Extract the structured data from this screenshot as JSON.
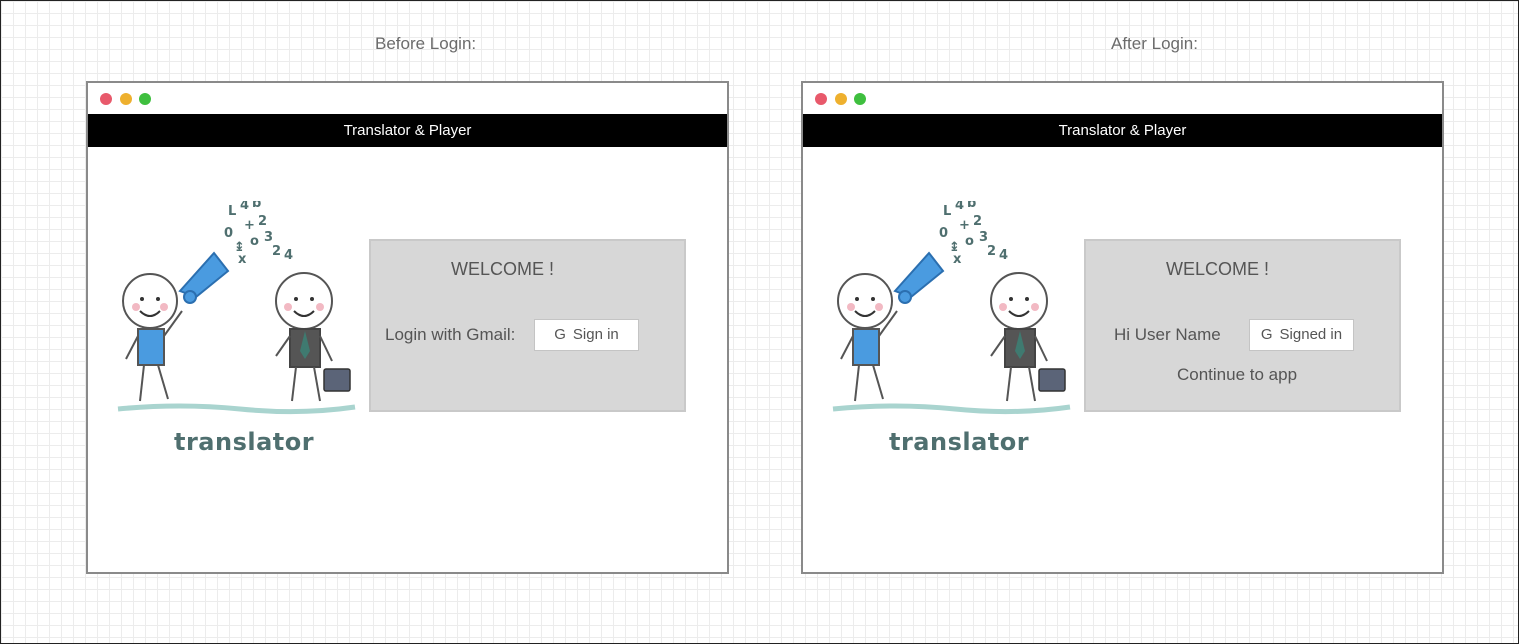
{
  "captions": {
    "before": "Before Login:",
    "after": "After Login:"
  },
  "before": {
    "window_title": "Translator & Player",
    "brand": "translator",
    "welcome": "WELCOME !",
    "login_label": "Login with Gmail:",
    "button_icon": "G",
    "button_label": "Sign in"
  },
  "after": {
    "window_title": "Translator & Player",
    "brand": "translator",
    "welcome": "WELCOME !",
    "greeting": "Hi User Name",
    "button_icon": "G",
    "button_label": "Signed in",
    "continue_label": "Continue to app"
  },
  "colors": {
    "traffic_red": "#e8596b",
    "traffic_yellow": "#eeb02e",
    "traffic_green": "#3fbf3f",
    "header_bg": "#000000",
    "panel_bg": "#d7d7d7",
    "megaphone": "#4a9be0",
    "brand_text": "#4f6f6f"
  },
  "icons": [
    "window-close-dot",
    "window-minimize-dot",
    "window-maximize-dot",
    "google-g-icon",
    "translator-illustration"
  ]
}
